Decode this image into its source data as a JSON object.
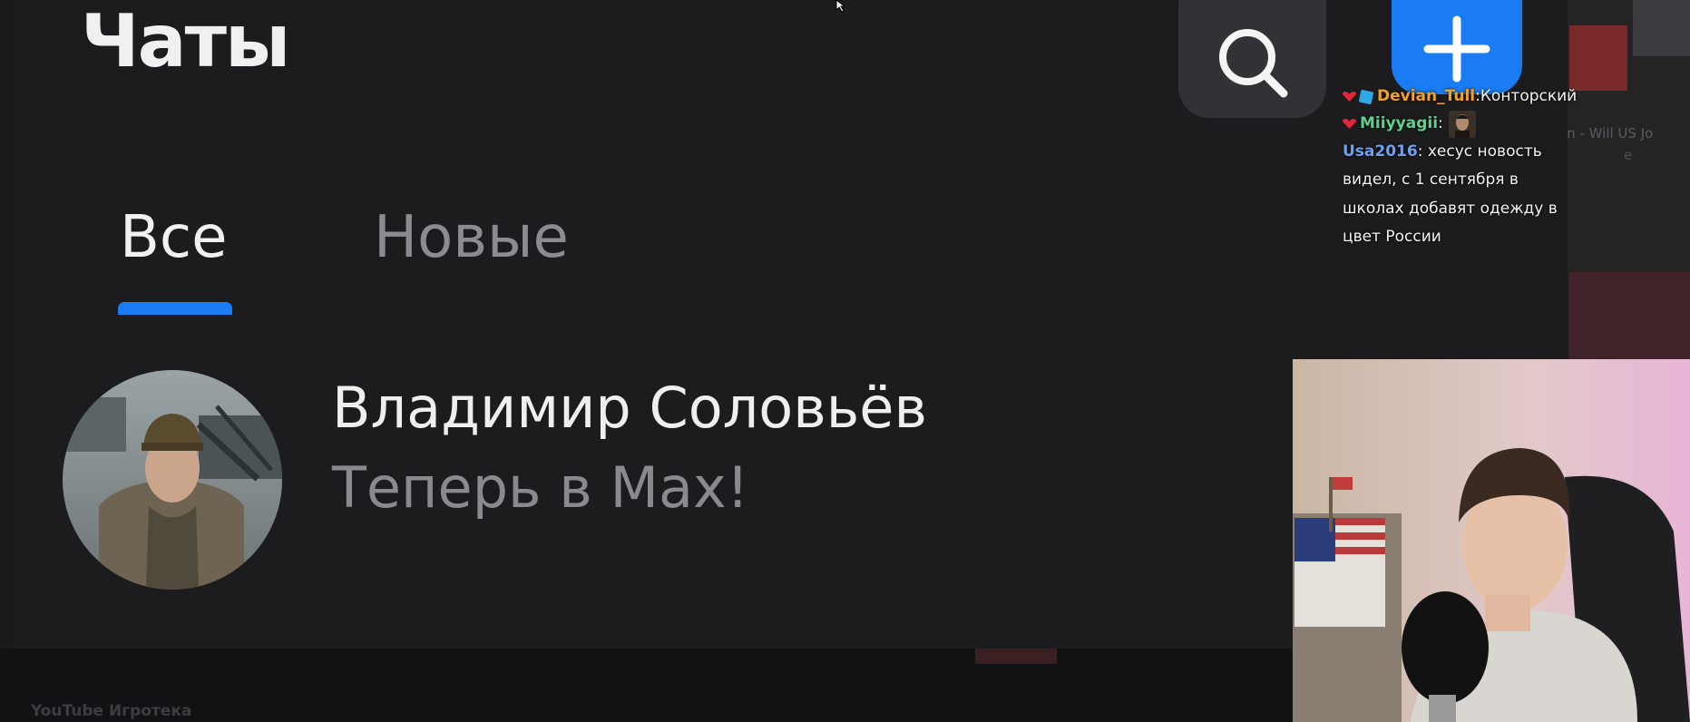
{
  "background": {
    "channel_name": "YouTube Игротека",
    "faded_title": "an - Will US Jo",
    "faded_subtitle": "e"
  },
  "app": {
    "title": "Чаты",
    "tabs": [
      {
        "label": "Все",
        "active": true
      },
      {
        "label": "Новые",
        "active": false
      }
    ],
    "chats": [
      {
        "name": "Владимир Соловьёв",
        "preview": "Теперь в Max!"
      }
    ],
    "colors": {
      "accent": "#1a7cf3",
      "panel": "#1c1c1f",
      "button": "#323236"
    },
    "icons": {
      "search": "search-icon",
      "compose": "plus-icon"
    }
  },
  "stream_chat": {
    "messages": [
      {
        "user": "Devian_Tull",
        "separator": ":",
        "text": " Конторский"
      },
      {
        "user": "Miiyyagii",
        "separator": ":",
        "text": ""
      },
      {
        "user": "Usa2016",
        "separator": ":",
        "text": " хесус новость видел, с 1 сентября в школах добавят одежду в цвет России"
      }
    ]
  }
}
